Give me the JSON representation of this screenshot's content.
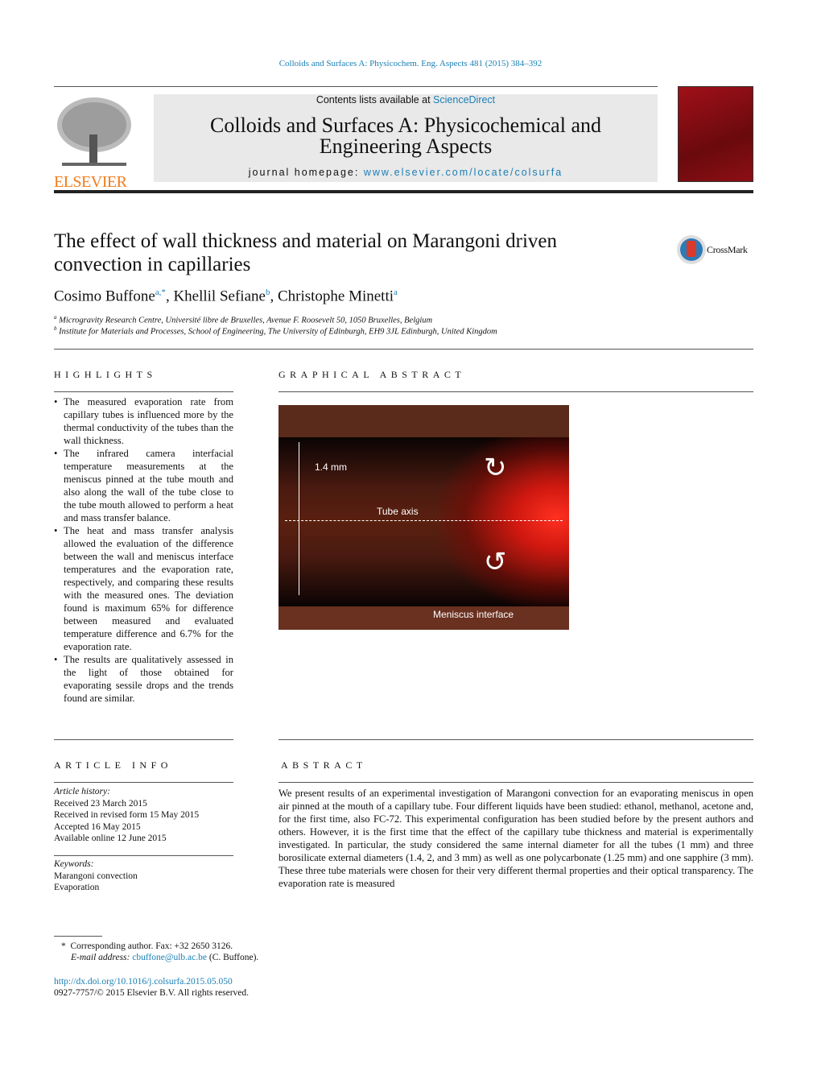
{
  "journal_ref": "Colloids and Surfaces A: Physicochem. Eng. Aspects 481 (2015) 384–392",
  "header": {
    "contents_prefix": "Contents lists available at ",
    "contents_link": "ScienceDirect",
    "journal_title": "Colloids and Surfaces A: Physicochemical and Engineering Aspects",
    "homepage_prefix": "journal homepage: ",
    "homepage_link": "www.elsevier.com/locate/colsurfa",
    "publisher": "ELSEVIER",
    "crossmark": "CrossMark"
  },
  "article": {
    "title": "The effect of wall thickness and material on Marangoni driven convection in capillaries",
    "authors": [
      {
        "name": "Cosimo Buffone",
        "sup": "a,*"
      },
      {
        "name": "Khellil Sefiane",
        "sup": "b"
      },
      {
        "name": "Christophe Minetti",
        "sup": "a"
      }
    ],
    "affiliations": [
      {
        "sup": "a",
        "text": "Microgravity Research Centre, Université libre de Bruxelles, Avenue F. Roosevelt 50, 1050 Bruxelles, Belgium"
      },
      {
        "sup": "b",
        "text": "Institute for Materials and Processes, School of Engineering, The University of Edinburgh, EH9 3JL Edinburgh, United Kingdom"
      }
    ]
  },
  "highlights": {
    "heading": "HIGHLIGHTS",
    "items": [
      "The measured evaporation rate from capillary tubes is influenced more by the thermal conductivity of the tubes than the wall thickness.",
      "The infrared camera interfacial temperature measurements at the meniscus pinned at the tube mouth and also along the wall of the tube close to the tube mouth allowed to perform a heat and mass transfer balance.",
      "The heat and mass transfer analysis allowed the evaluation of the difference between the wall and meniscus interface temperatures and the evaporation rate, respectively, and comparing these results with the measured ones. The deviation found is maximum 65% for difference between measured and evaluated temperature difference and 6.7% for the evaporation rate.",
      "The results are qualitatively assessed in the light of those obtained for evaporating sessile drops and the trends found are similar."
    ]
  },
  "graphical_abstract": {
    "heading": "GRAPHICAL ABSTRACT",
    "labels": {
      "diameter": "1.4 mm",
      "axis": "Tube axis",
      "meniscus": "Meniscus interface"
    }
  },
  "article_info": {
    "heading": "ARTICLE INFO",
    "history_label": "Article history:",
    "history": [
      "Received 23 March 2015",
      "Received in revised form 15 May 2015",
      "Accepted 16 May 2015",
      "Available online 12 June 2015"
    ],
    "keywords_label": "Keywords:",
    "keywords": [
      "Marangoni convection",
      "Evaporation"
    ]
  },
  "abstract": {
    "heading": "ABSTRACT",
    "text": "We present results of an experimental investigation of Marangoni convection for an evaporating meniscus in open air pinned at the mouth of a capillary tube. Four different liquids have been studied: ethanol, methanol, acetone and, for the first time, also FC-72. This experimental configuration has been studied before by the present authors and others. However, it is the first time that the effect of the capillary tube thickness and material is experimentally investigated. In particular, the study considered the same internal diameter for all the tubes (1 mm) and three borosilicate external diameters (1.4, 2, and 3 mm) as well as one polycarbonate (1.25 mm) and one sapphire (3 mm). These three tube materials were chosen for their very different thermal properties and their optical transparency. The evaporation rate is measured"
  },
  "footer": {
    "star": "*",
    "corresponding": "Corresponding author. Fax: +32 2650 3126.",
    "email_label": "E-mail address: ",
    "email": "cbuffone@ulb.ac.be",
    "email_suffix": " (C. Buffone).",
    "doi": "http://dx.doi.org/10.1016/j.colsurfa.2015.05.050",
    "copyright": "0927-7757/© 2015 Elsevier B.V. All rights reserved."
  },
  "colors": {
    "link": "#1a7fb5",
    "elsevier": "#f07c1a"
  }
}
